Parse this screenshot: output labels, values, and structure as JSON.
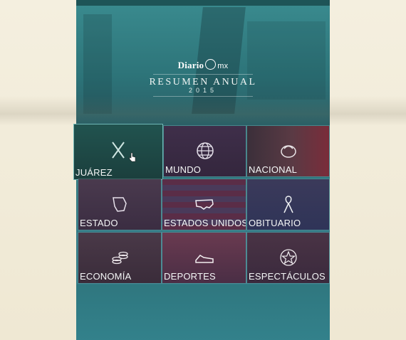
{
  "brand": {
    "logo_text": "Diario",
    "logo_suffix": "mx",
    "title": "RESUMEN ANUAL",
    "year": "2015"
  },
  "sections": [
    {
      "label": "JUÁREZ",
      "icon": "x-icon"
    },
    {
      "label": "MUNDO",
      "icon": "globe-icon"
    },
    {
      "label": "NACIONAL",
      "icon": "eagle-emblem-icon"
    },
    {
      "label": "ESTADO",
      "icon": "state-map-icon"
    },
    {
      "label": "ESTADOS UNIDOS",
      "icon": "usa-map-icon"
    },
    {
      "label": "OBITUARIO",
      "icon": "ribbon-icon"
    },
    {
      "label": "ECONOMÍA",
      "icon": "coins-icon"
    },
    {
      "label": "DEPORTES",
      "icon": "sneaker-icon"
    },
    {
      "label": "ESPECTÁCULOS",
      "icon": "star-icon"
    }
  ],
  "active_section": "JUÁREZ",
  "colors": {
    "teal": "#2e7f85",
    "tile_dark": "#3b2a44",
    "side_cream": "#f2ecdb"
  }
}
